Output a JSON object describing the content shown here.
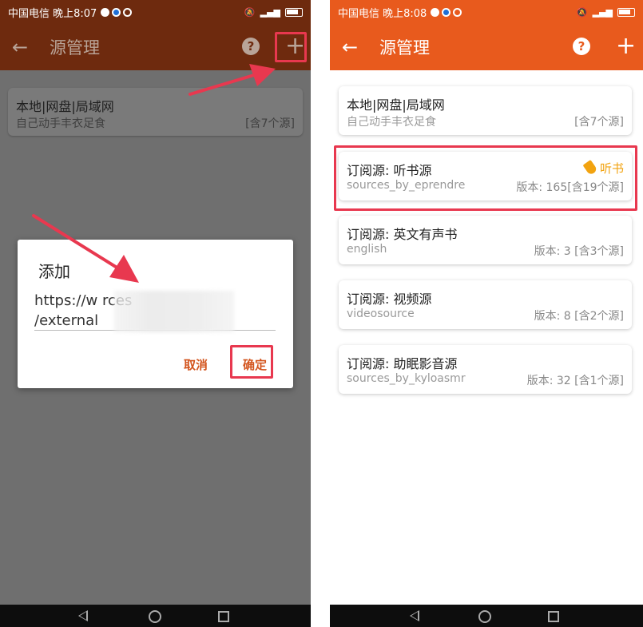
{
  "left": {
    "status": {
      "carrier_time": "中国电信 晚上8:07"
    },
    "appbar": {
      "title": "源管理",
      "help_glyph": "?",
      "add_glyph": "+",
      "back_glyph": "←"
    },
    "cards": [
      {
        "title": "本地|网盘|局域网",
        "subtitle": "自己动手丰衣足食",
        "meta": "[含7个源]"
      }
    ],
    "dialog": {
      "title": "添加",
      "input_line1": "https://w              rces",
      "input_line2": "/external",
      "cancel": "取消",
      "ok": "确定"
    }
  },
  "right": {
    "status": {
      "carrier_time": "中国电信 晚上8:08"
    },
    "appbar": {
      "title": "源管理",
      "help_glyph": "?",
      "add_glyph": "+",
      "back_glyph": "←"
    },
    "cards": [
      {
        "title": "本地|网盘|局域网",
        "subtitle": "自己动手丰衣足食",
        "meta": "[含7个源]"
      },
      {
        "title": "订阅源: 听书源",
        "subtitle": "sources_by_eprendre",
        "meta": "版本: 165[含19个源]",
        "tag": "听书"
      },
      {
        "title": "订阅源: 英文有声书",
        "subtitle": "english",
        "meta": "版本: 3 [含3个源]"
      },
      {
        "title": "订阅源: 视频源",
        "subtitle": "videosource",
        "meta": "版本: 8 [含2个源]"
      },
      {
        "title": "订阅源: 助眠影音源",
        "subtitle": "sources_by_kyloasmr",
        "meta": "版本: 32 [含1个源]"
      }
    ]
  },
  "colors": {
    "appbar_dim": "#6e2a0e",
    "appbar_active": "#e85a1d",
    "annotation_red": "#e8384f",
    "tag_yellow": "#f2a310",
    "dialog_button": "#d3551e"
  }
}
